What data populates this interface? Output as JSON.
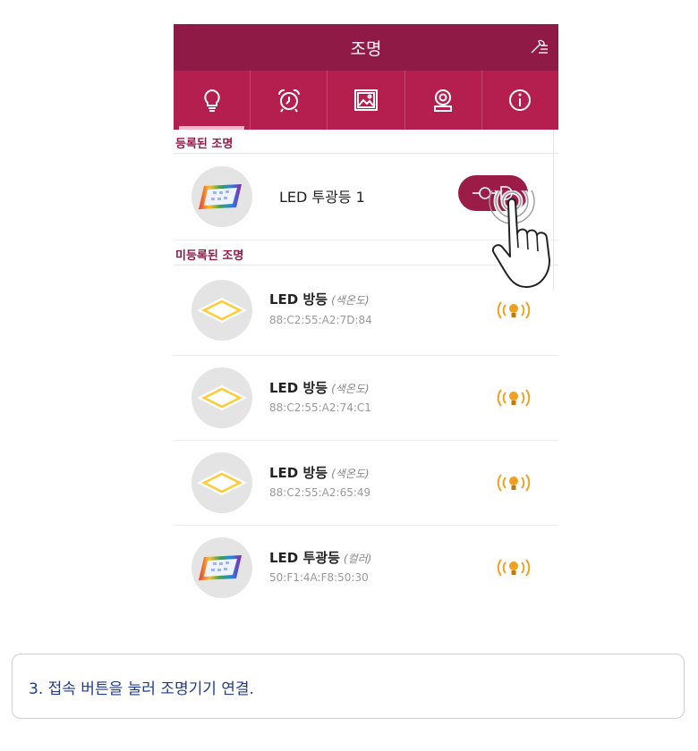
{
  "appbar": {
    "title": "조명",
    "settings_icon": "settings-wrench-icon"
  },
  "tabs": [
    {
      "icon": "bulb-icon",
      "active": true
    },
    {
      "icon": "alarm-clock-icon",
      "active": false
    },
    {
      "icon": "picture-icon",
      "active": false
    },
    {
      "icon": "camera-icon",
      "active": false
    },
    {
      "icon": "info-icon",
      "active": false
    }
  ],
  "registered": {
    "header": "등록된 조명",
    "items": [
      {
        "name": "LED 투광등 1",
        "button_icon": "plug-connect-icon"
      }
    ]
  },
  "unregistered": {
    "header": "미등록된 조명",
    "items": [
      {
        "name": "LED 방등",
        "sub": "(색온도)",
        "mac": "88:C2:55:A2:7D:84",
        "type": "ceiling"
      },
      {
        "name": "LED 방등",
        "sub": "(색온도)",
        "mac": "88:C2:55:A2:74:C1",
        "type": "ceiling"
      },
      {
        "name": "LED 방등",
        "sub": "(색온도)",
        "mac": "88:C2:55:A2:65:49",
        "type": "ceiling"
      },
      {
        "name": "LED 투광등",
        "sub": "(컬러)",
        "mac": "50:F1:4A:F8:50:30",
        "type": "flood"
      }
    ]
  },
  "caption": "3. 접속 버튼을 눌러 조명기기 연결.",
  "colors": {
    "appbar": "#8e1a45",
    "tabbar": "#b51f4f",
    "accent": "#9b1c47",
    "signal": "#f0a020",
    "caption": "#1f3b8a"
  }
}
